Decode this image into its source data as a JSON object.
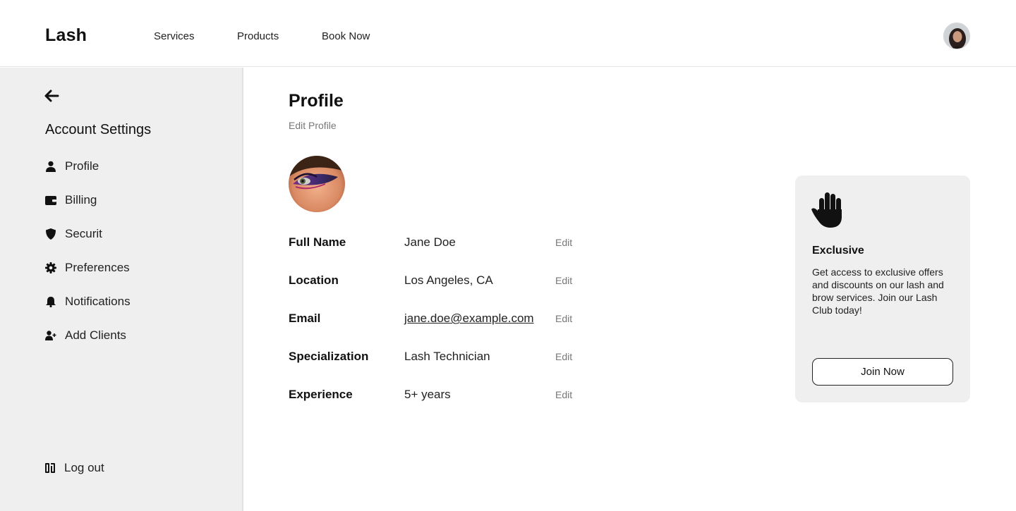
{
  "header": {
    "logo": "Lash",
    "nav": [
      {
        "label": "Services"
      },
      {
        "label": "Products"
      },
      {
        "label": "Book Now"
      }
    ],
    "avatar_icon": "user-avatar"
  },
  "sidebar": {
    "back_icon": "arrow-left-icon",
    "title": "Account Settings",
    "items": [
      {
        "label": "Profile",
        "icon": "user-icon"
      },
      {
        "label": "Billing",
        "icon": "wallet-icon"
      },
      {
        "label": "Securit",
        "icon": "shield-icon"
      },
      {
        "label": "Preferences",
        "icon": "gear-icon"
      },
      {
        "label": "Notifications",
        "icon": "bell-icon"
      },
      {
        "label": "Add Clients",
        "icon": "user-plus-icon"
      }
    ],
    "logout": {
      "label": "Log out",
      "icon": "logout-icon"
    }
  },
  "main": {
    "title": "Profile",
    "subtitle": "Edit Profile",
    "fields": [
      {
        "label": "Full Name",
        "value": "Jane Doe",
        "action": "Edit"
      },
      {
        "label": "Location",
        "value": "Los Angeles, CA",
        "action": "Edit"
      },
      {
        "label": "Email",
        "value": "jane.doe@example.com",
        "action": "Edit"
      },
      {
        "label": "Specialization",
        "value": "Lash Technician",
        "action": "Edit"
      },
      {
        "label": "Experience",
        "value": "5+ years",
        "action": "Edit"
      }
    ]
  },
  "promo": {
    "icon": "hand-icon",
    "title": "Exclusive",
    "text": "Get access to exclusive offers and discounts on our lash and brow services. Join our Lash Club today!",
    "button": "Join Now"
  },
  "colors": {
    "sidebar_bg": "#efefef",
    "promo_bg": "#efefef",
    "text": "#111111",
    "muted": "#777777"
  }
}
